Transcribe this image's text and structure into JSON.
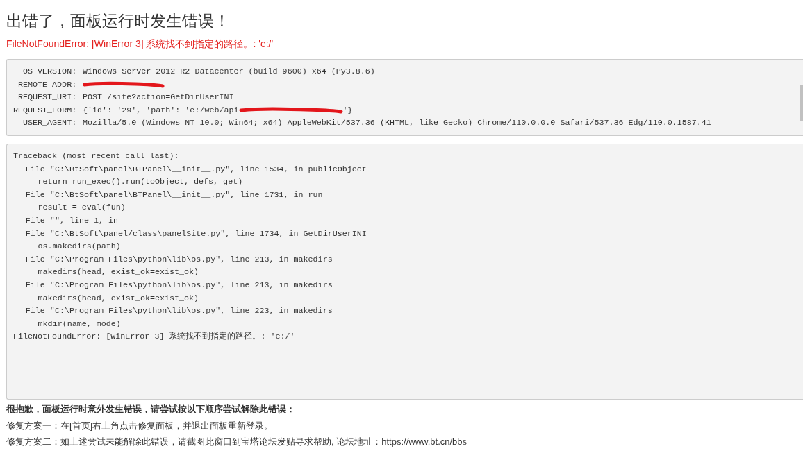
{
  "title": "出错了，面板运行时发生错误！",
  "error_message": "FileNotFoundError: [WinError 3] 系统找不到指定的路径。: 'e:/'",
  "environment": [
    {
      "label": "OS_VERSION:",
      "parts": [
        {
          "kind": "text",
          "text": "Windows Server 2012 R2 Datacenter (build 9600) x64 (Py3.8.6)"
        }
      ]
    },
    {
      "label": "REMOTE_ADDR:",
      "parts": [
        {
          "kind": "redaction"
        }
      ]
    },
    {
      "label": "REQUEST_URI:",
      "parts": [
        {
          "kind": "text",
          "text": "POST /site?action=GetDirUserINI"
        }
      ]
    },
    {
      "label": "REQUEST_FORM:",
      "parts": [
        {
          "kind": "text",
          "text": "{'id': '29', 'path': 'e:/web/api"
        },
        {
          "kind": "redaction"
        },
        {
          "kind": "text",
          "text": "'}"
        }
      ]
    },
    {
      "label": "USER_AGENT:",
      "parts": [
        {
          "kind": "text",
          "text": "Mozilla/5.0 (Windows NT 10.0; Win64; x64) AppleWebKit/537.36 (KHTML, like Gecko) Chrome/110.0.0.0 Safari/537.36 Edg/110.0.1587.41"
        }
      ]
    }
  ],
  "traceback": [
    {
      "kind": "header",
      "text": "Traceback (most recent call last):"
    },
    {
      "kind": "frame",
      "text": "File \"C:\\BtSoft\\panel\\BTPanel\\__init__.py\", line 1534, in publicObject"
    },
    {
      "kind": "code",
      "text": "return run_exec().run(toObject, defs, get)"
    },
    {
      "kind": "frame",
      "text": "File \"C:\\BtSoft\\panel\\BTPanel\\__init__.py\", line 1731, in run"
    },
    {
      "kind": "code",
      "text": "result = eval(fun)"
    },
    {
      "kind": "frame",
      "text": "File \"\", line 1, in"
    },
    {
      "kind": "frame",
      "text": "File \"C:\\BtSoft\\panel/class\\panelSite.py\", line 1734, in GetDirUserINI"
    },
    {
      "kind": "code",
      "text": "os.makedirs(path)"
    },
    {
      "kind": "frame",
      "text": "File \"C:\\Program Files\\python\\lib\\os.py\", line 213, in makedirs"
    },
    {
      "kind": "code",
      "text": "makedirs(head, exist_ok=exist_ok)"
    },
    {
      "kind": "frame",
      "text": "File \"C:\\Program Files\\python\\lib\\os.py\", line 213, in makedirs"
    },
    {
      "kind": "code",
      "text": "makedirs(head, exist_ok=exist_ok)"
    },
    {
      "kind": "frame",
      "text": "File \"C:\\Program Files\\python\\lib\\os.py\", line 223, in makedirs"
    },
    {
      "kind": "code",
      "text": "mkdir(name, mode)"
    },
    {
      "kind": "error",
      "text": "FileNotFoundError: [WinError 3] 系统找不到指定的路径。: 'e:/'"
    }
  ],
  "help": {
    "heading": "很抱歉，面板运行时意外发生错误，请尝试按以下顺序尝试解除此错误：",
    "steps": [
      "修复方案一：在[首页]右上角点击修复面板，并退出面板重新登录。",
      "修复方案二：如上述尝试未能解除此错误，请截图此窗口到宝塔论坛发贴寻求帮助, 论坛地址：https://www.bt.cn/bbs"
    ]
  }
}
